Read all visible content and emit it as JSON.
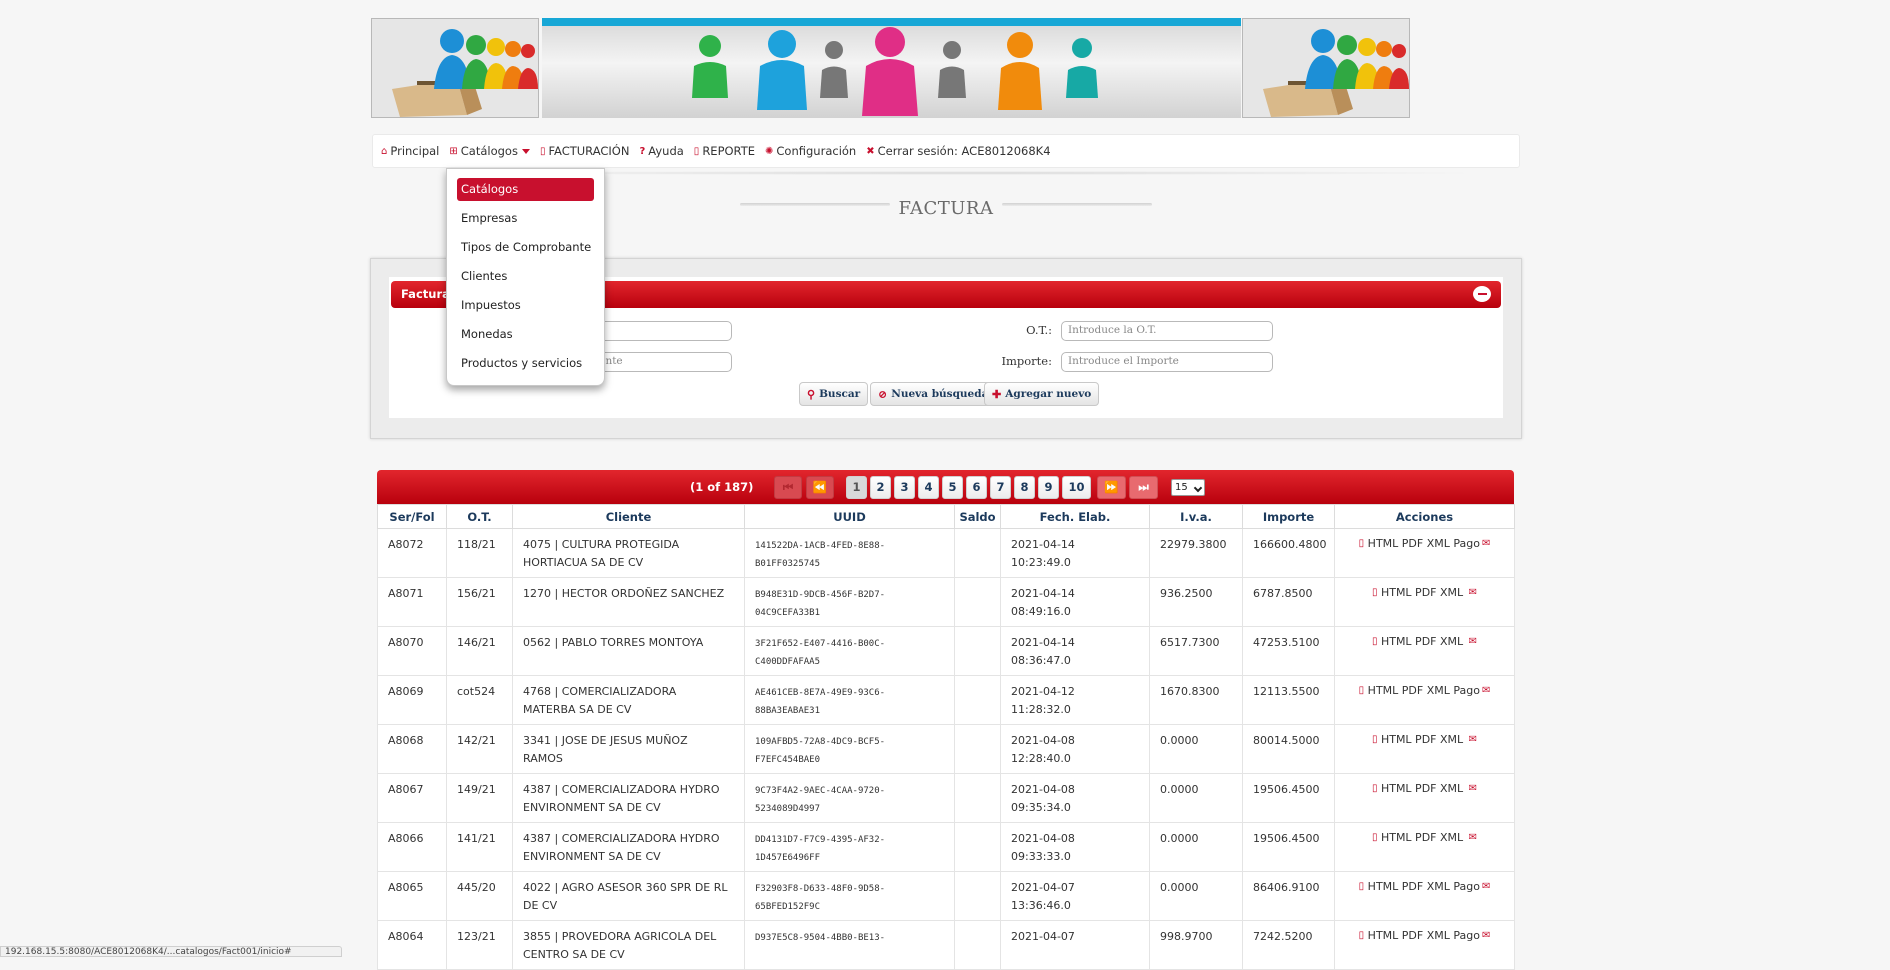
{
  "menu": {
    "items": [
      {
        "icon": "home-icon",
        "label": "Principal"
      },
      {
        "icon": "grid-icon",
        "label": "Catálogos"
      },
      {
        "icon": "document-icon",
        "label": "FACTURACIÓN"
      },
      {
        "icon": "help-icon",
        "label": "Ayuda"
      },
      {
        "icon": "document-icon",
        "label": "REPORTE"
      },
      {
        "icon": "gear-icon",
        "label": "Configuración"
      },
      {
        "icon": "close-icon",
        "label": "Cerrar sesión: ACE8012068K4"
      }
    ]
  },
  "dropdown": {
    "items": [
      "Catálogos",
      "Empresas",
      "Tipos de Comprobante",
      "Clientes",
      "Impuestos",
      "Monedas",
      "Productos y servicios"
    ]
  },
  "page_title": "FACTURA",
  "search": {
    "panel_title": "Factura",
    "field1_placeholder": "",
    "field2_placeholder": "del cliente",
    "ot_label": "O.T.:",
    "ot_placeholder": "Introduce la O.T.",
    "importe_label": "Importe:",
    "importe_placeholder": "Introduce el Importe",
    "buttons": {
      "search": "Buscar",
      "new_search": "Nueva búsqueda",
      "add_new": "Agregar nuevo"
    }
  },
  "pager": {
    "status": "(1 of 187)",
    "first": "⏮",
    "prev": "⏪",
    "next": "⏩",
    "last": "⏭",
    "pages": [
      "1",
      "2",
      "3",
      "4",
      "5",
      "6",
      "7",
      "8",
      "9",
      "10"
    ],
    "rows_per_page": "15"
  },
  "table": {
    "headers": [
      "Ser/Fol",
      "O.T.",
      "Cliente",
      "UUID",
      "Saldo",
      "Fech. Elab.",
      "I.v.a.",
      "Importe",
      "Acciones"
    ],
    "rows": [
      {
        "serfol": "A8072",
        "ot": "118/21",
        "cliente1": "4075 | CULTURA PROTEGIDA",
        "cliente2": "HORTIACUA SA DE CV",
        "uuid1": "141522DA-1ACB-4FED-8E88-",
        "uuid2": "B01FF0325745",
        "saldo": "",
        "fecha1": "2021-04-14",
        "fecha2": "10:23:49.0",
        "iva": "22979.3800",
        "importe": "166600.4800",
        "acciones": "HTML PDF XML Pago"
      },
      {
        "serfol": "A8071",
        "ot": "156/21",
        "cliente1": "1270 | HECTOR ORDOÑEZ SANCHEZ",
        "cliente2": "",
        "uuid1": "B948E31D-9DCB-456F-B2D7-",
        "uuid2": "04C9CEFA33B1",
        "saldo": "",
        "fecha1": "2021-04-14",
        "fecha2": "08:49:16.0",
        "iva": "936.2500",
        "importe": "6787.8500",
        "acciones": "HTML PDF XML"
      },
      {
        "serfol": "A8070",
        "ot": "146/21",
        "cliente1": "0562 | PABLO TORRES MONTOYA",
        "cliente2": "",
        "uuid1": "3F21F652-E407-4416-B00C-",
        "uuid2": "C400DDFAFAA5",
        "saldo": "",
        "fecha1": "2021-04-14",
        "fecha2": "08:36:47.0",
        "iva": "6517.7300",
        "importe": "47253.5100",
        "acciones": "HTML PDF XML"
      },
      {
        "serfol": "A8069",
        "ot": "cot524",
        "cliente1": "4768 | COMERCIALIZADORA",
        "cliente2": "MATERBA SA DE CV",
        "uuid1": "AE461CEB-8E7A-49E9-93C6-",
        "uuid2": "88BA3EABAE31",
        "saldo": "",
        "fecha1": "2021-04-12",
        "fecha2": "11:28:32.0",
        "iva": "1670.8300",
        "importe": "12113.5500",
        "acciones": "HTML PDF XML Pago"
      },
      {
        "serfol": "A8068",
        "ot": "142/21",
        "cliente1": "3341 | JOSE DE JESUS MUÑOZ",
        "cliente2": "RAMOS",
        "uuid1": "109AFBD5-72A8-4DC9-BCF5-",
        "uuid2": "F7EFC454BAE0",
        "saldo": "",
        "fecha1": "2021-04-08",
        "fecha2": "12:28:40.0",
        "iva": "0.0000",
        "importe": "80014.5000",
        "acciones": "HTML PDF XML"
      },
      {
        "serfol": "A8067",
        "ot": "149/21",
        "cliente1": "4387 | COMERCIALIZADORA HYDRO",
        "cliente2": "ENVIRONMENT SA DE CV",
        "uuid1": "9C73F4A2-9AEC-4CAA-9720-",
        "uuid2": "5234089D4997",
        "saldo": "",
        "fecha1": "2021-04-08",
        "fecha2": "09:35:34.0",
        "iva": "0.0000",
        "importe": "19506.4500",
        "acciones": "HTML PDF XML"
      },
      {
        "serfol": "A8066",
        "ot": "141/21",
        "cliente1": "4387 | COMERCIALIZADORA HYDRO",
        "cliente2": "ENVIRONMENT SA DE CV",
        "uuid1": "DD4131D7-F7C9-4395-AF32-",
        "uuid2": "1D457E6496FF",
        "saldo": "",
        "fecha1": "2021-04-08",
        "fecha2": "09:33:33.0",
        "iva": "0.0000",
        "importe": "19506.4500",
        "acciones": "HTML PDF XML"
      },
      {
        "serfol": "A8065",
        "ot": "445/20",
        "cliente1": "4022 | AGRO ASESOR 360 SPR DE RL",
        "cliente2": "DE CV",
        "uuid1": "F32903F8-D633-48F0-9D58-",
        "uuid2": "65BFED152F9C",
        "saldo": "",
        "fecha1": "2021-04-07",
        "fecha2": "13:36:46.0",
        "iva": "0.0000",
        "importe": "86406.9100",
        "acciones": "HTML PDF XML Pago"
      },
      {
        "serfol": "A8064",
        "ot": "123/21",
        "cliente1": "3855 | PROVEDORA AGRICOLA DEL",
        "cliente2": "CENTRO SA DE CV",
        "uuid1": "D937E5C8-9504-4BB0-BE13-",
        "uuid2": "",
        "saldo": "",
        "fecha1": "2021-04-07",
        "fecha2": "",
        "iva": "998.9700",
        "importe": "7242.5200",
        "acciones": "HTML PDF XML Pago"
      }
    ]
  },
  "statusbar": {
    "url": "192.168.15.5:8080/ACE8012068K4/...catalogos/Fact001/inicio#"
  },
  "colors": {
    "accent": "#c8102e",
    "header_text": "#1c3a5c"
  }
}
